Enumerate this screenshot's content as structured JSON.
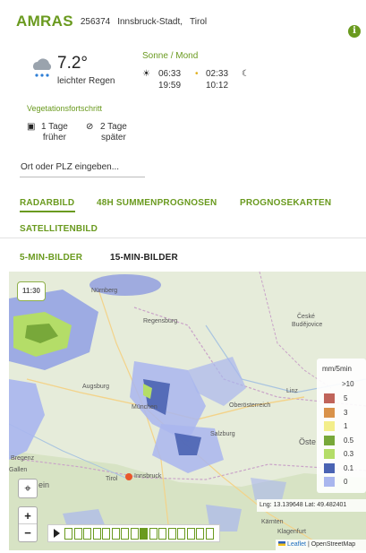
{
  "header": {
    "place_name": "AMRAS",
    "place_id": "256374",
    "region": "Innsbruck-Stadt,",
    "state": "Tirol",
    "info_icon": "i"
  },
  "weather": {
    "temperature": "7.2°",
    "condition": "leichter Regen",
    "icon": "cloud-rain-icon"
  },
  "sun_moon": {
    "title": "Sonne / Mond",
    "sunrise": "06:33",
    "sunset": "19:59",
    "moonrise": "02:33",
    "moonset": "10:12"
  },
  "vegetation": {
    "title": "Vegetationsfortschritt",
    "item1_line1": "1 Tage",
    "item1_line2": "früher",
    "item2_line1": "2 Tage",
    "item2_line2": "später"
  },
  "search": {
    "placeholder": "Ort oder PLZ eingeben..."
  },
  "tabs": [
    "RADARBILD",
    "48H SUMMENPROGNOSEN",
    "PROGNOSEKARTEN",
    "SATELLITENBILD"
  ],
  "subtabs": [
    "5-MIN-BILDER",
    "15-MIN-BILDER"
  ],
  "map": {
    "time": "11:30",
    "labels": {
      "nuernberg": "Nürnberg",
      "regensburg": "Regensburg",
      "ceske": "České",
      "budejovice": "Budějovice",
      "augsburg": "Augsburg",
      "muenchen": "München",
      "linz": "Linz",
      "oberoesterreich": "Oberösterreich",
      "salzburg": "Salzburg",
      "oste": "Öste",
      "bregenz": "Bregenz",
      "gallen": "Gallen",
      "innsbruck": "Innsbruck",
      "tirol": "Tirol",
      "ein": "ein",
      "klagenfurt": "Klagenfurt",
      "kaernten": "Kärnten"
    },
    "legend": {
      "title": "mm/5min",
      "top": ">10",
      "items": [
        {
          "label": "5",
          "color": "#c0645a"
        },
        {
          "label": "3",
          "color": "#d9924a"
        },
        {
          "label": "1",
          "color": "#f3ee8a"
        },
        {
          "label": "0.5",
          "color": "#78a83a"
        },
        {
          "label": "0.3",
          "color": "#b4dd68"
        },
        {
          "label": "0.1",
          "color": "#4a63b3"
        },
        {
          "label": "0",
          "color": "#a9b6ee"
        }
      ]
    },
    "coords": "Lng: 13.139648 Lat: 49.482401",
    "zoom_in": "+",
    "zoom_out": "−",
    "locate_icon": "crosshair-icon",
    "frames_total": 16,
    "frame_active": 9,
    "attribution_link": "Leaflet",
    "attribution_rest": "| OpenStreetMap"
  },
  "colors": {
    "accent": "#6a9a1f",
    "rain_light": "#a9b6ee",
    "rain_medium": "#4a63b3"
  }
}
